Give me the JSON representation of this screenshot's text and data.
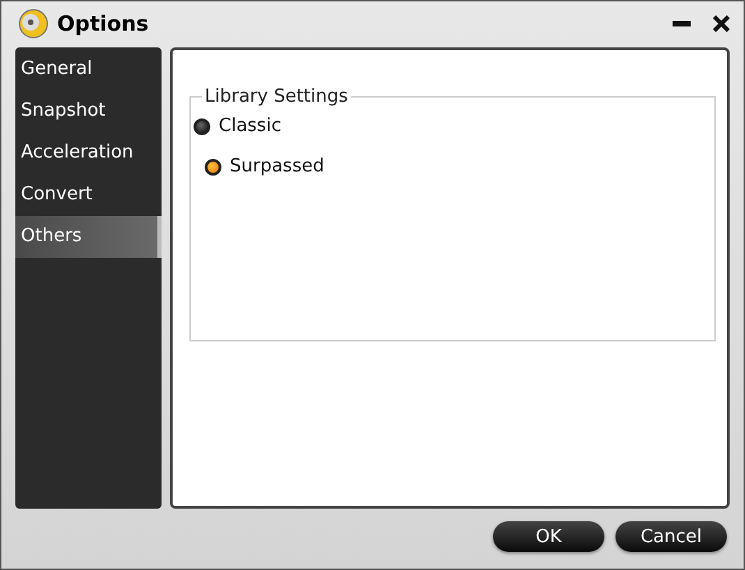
{
  "window": {
    "title": "Options"
  },
  "sidebar": {
    "items": [
      {
        "label": "General",
        "selected": false
      },
      {
        "label": "Snapshot",
        "selected": false
      },
      {
        "label": "Acceleration",
        "selected": false
      },
      {
        "label": "Convert",
        "selected": false
      },
      {
        "label": "Others",
        "selected": true
      }
    ]
  },
  "library_settings": {
    "title": "Library Settings",
    "options": [
      {
        "label": "Classic",
        "selected": false
      },
      {
        "label": "Surpassed",
        "selected": true
      }
    ]
  },
  "buttons": [
    "OK",
    "Cancel"
  ]
}
